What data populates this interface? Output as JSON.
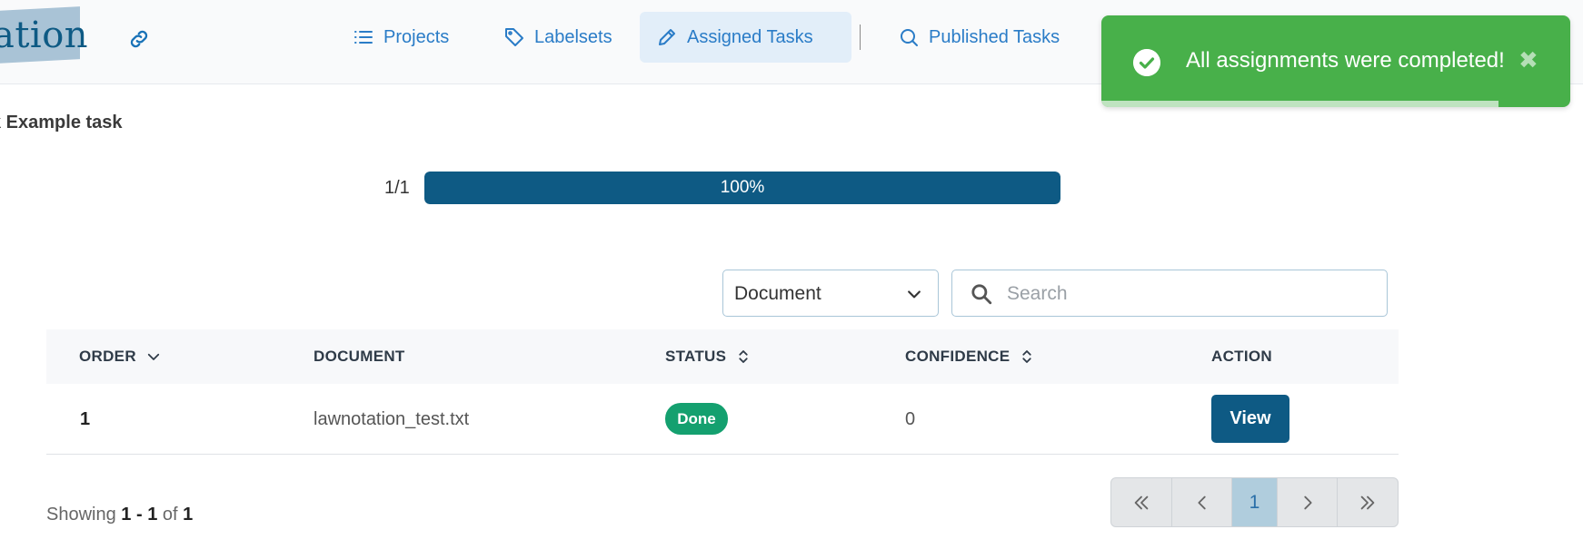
{
  "brand": {
    "logo_text": "ation"
  },
  "nav": {
    "items": [
      {
        "label": "Projects",
        "icon": "list-icon"
      },
      {
        "label": "Labelsets",
        "icon": "tag-icon"
      },
      {
        "label": "Assigned Tasks",
        "icon": "pencil-icon",
        "active": true
      },
      {
        "label": "Published Tasks",
        "icon": "search-icon"
      }
    ]
  },
  "toast": {
    "message": "All assignments were completed!",
    "close": "✖",
    "color": "#48b04a"
  },
  "breadcrumb": "k Example task",
  "progress": {
    "count": "1/1",
    "percent_label": "100%",
    "fraction": 1.0
  },
  "filter": {
    "selected": "Document"
  },
  "search": {
    "placeholder": "Search"
  },
  "table": {
    "columns": [
      "ORDER",
      "DOCUMENT",
      "STATUS",
      "CONFIDENCE",
      "ACTION"
    ],
    "rows": [
      {
        "order": "1",
        "document": "lawnotation_test.txt",
        "status": "Done",
        "confidence": "0",
        "action": "View"
      }
    ]
  },
  "pagination": {
    "showing_prefix": "Showing",
    "range_start": "1",
    "range_sep": " - ",
    "range_end": "1",
    "of_label": "of",
    "total": "1",
    "current_page": "1"
  },
  "colors": {
    "primary": "#0e5a84",
    "link": "#2a7cc7",
    "success": "#14a06f"
  }
}
